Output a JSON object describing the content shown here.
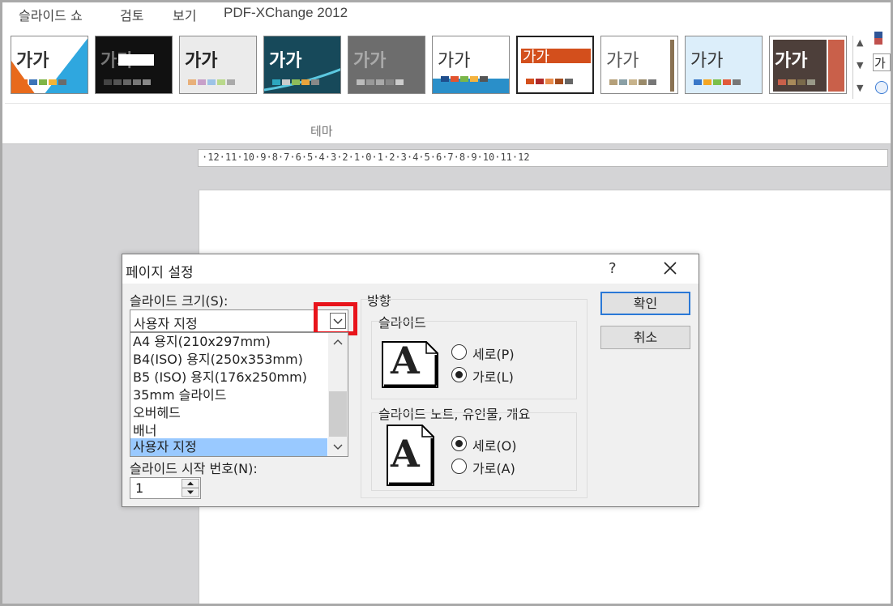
{
  "menubar": {
    "items": [
      "슬라이드 쇼",
      "검토",
      "보기",
      "PDF-XChange 2012"
    ]
  },
  "ribbon": {
    "theme_thumb_text": "가가",
    "group_label": "테마",
    "right_glyph": "가"
  },
  "ruler": {
    "text": "·12·11·10·9·8·7·6·5·4·3·2·1·0·1·2·3·4·5·6·7·8·9·10·11·12"
  },
  "dialog": {
    "title": "페이지 설정",
    "help": "?",
    "slide_size_label": "슬라이드 크기(S):",
    "slide_size_value": "사용자 지정",
    "slide_size_options": [
      "A4 용지(210x297mm)",
      "B4(ISO) 용지(250x353mm)",
      "B5 (ISO) 용지(176x250mm)",
      "35mm 슬라이드",
      "오버헤드",
      "배너",
      "사용자 지정"
    ],
    "start_number_label": "슬라이드 시작 번호(N):",
    "start_number_value": "1",
    "orientation_label": "방향",
    "slides_group_label": "슬라이드",
    "slides_portrait": "세로(P)",
    "slides_landscape": "가로(L)",
    "notes_group_label": "슬라이드 노트, 유인물, 개요",
    "notes_portrait": "세로(O)",
    "notes_landscape": "가로(A)",
    "ok_label": "확인",
    "cancel_label": "취소",
    "icon_letter": "A"
  }
}
